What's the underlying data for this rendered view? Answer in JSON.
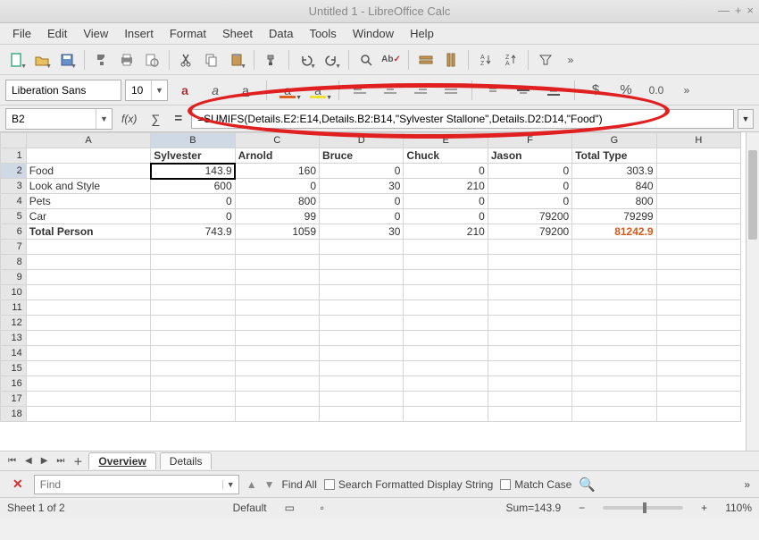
{
  "window": {
    "title": "Untitled 1 - LibreOffice Calc"
  },
  "menu": {
    "items": [
      "File",
      "Edit",
      "View",
      "Insert",
      "Format",
      "Sheet",
      "Data",
      "Tools",
      "Window",
      "Help"
    ]
  },
  "font_row": {
    "font_name": "Liberation Sans",
    "font_size": "10",
    "percent_label": "%",
    "dollar_label": "$",
    "zero_label": "0.0"
  },
  "cellref": {
    "active_cell": "B2",
    "fx_label": "f(x)",
    "formula": "=SUMIFS(Details.E2:E14,Details.B2:B14,\"Sylvester Stallone\",Details.D2:D14,\"Food\")"
  },
  "columns": [
    "A",
    "B",
    "C",
    "D",
    "E",
    "F",
    "G",
    "H"
  ],
  "rows_shown": 18,
  "headers": {
    "B": "Sylvester",
    "C": "Arnold",
    "D": "Bruce",
    "E": "Chuck",
    "F": "Jason",
    "G": "Total Type"
  },
  "row_labels": {
    "2": "Food",
    "3": "Look and Style",
    "4": "Pets",
    "5": "Car",
    "6": "Total Person"
  },
  "cells": {
    "B2": "143.9",
    "C2": "160",
    "D2": "0",
    "E2": "0",
    "F2": "0",
    "G2": "303.9",
    "B3": "600",
    "C3": "0",
    "D3": "30",
    "E3": "210",
    "F3": "0",
    "G3": "840",
    "B4": "0",
    "C4": "800",
    "D4": "0",
    "E4": "0",
    "F4": "0",
    "G4": "800",
    "B5": "0",
    "C5": "99",
    "D5": "0",
    "E5": "0",
    "F5": "79200",
    "G5": "79299",
    "B6": "743.9",
    "C6": "1059",
    "D6": "30",
    "E6": "210",
    "F6": "79200",
    "G6": "81242.9"
  },
  "sheet_tabs": {
    "active": "Overview",
    "other": "Details"
  },
  "findbar": {
    "placeholder": "Find",
    "find_all": "Find All",
    "search_formatted": "Search Formatted Display String",
    "match_case": "Match Case"
  },
  "status": {
    "sheet_info": "Sheet 1 of 2",
    "lang": "Default",
    "sum": "Sum=143.9",
    "zoom": "110%"
  }
}
